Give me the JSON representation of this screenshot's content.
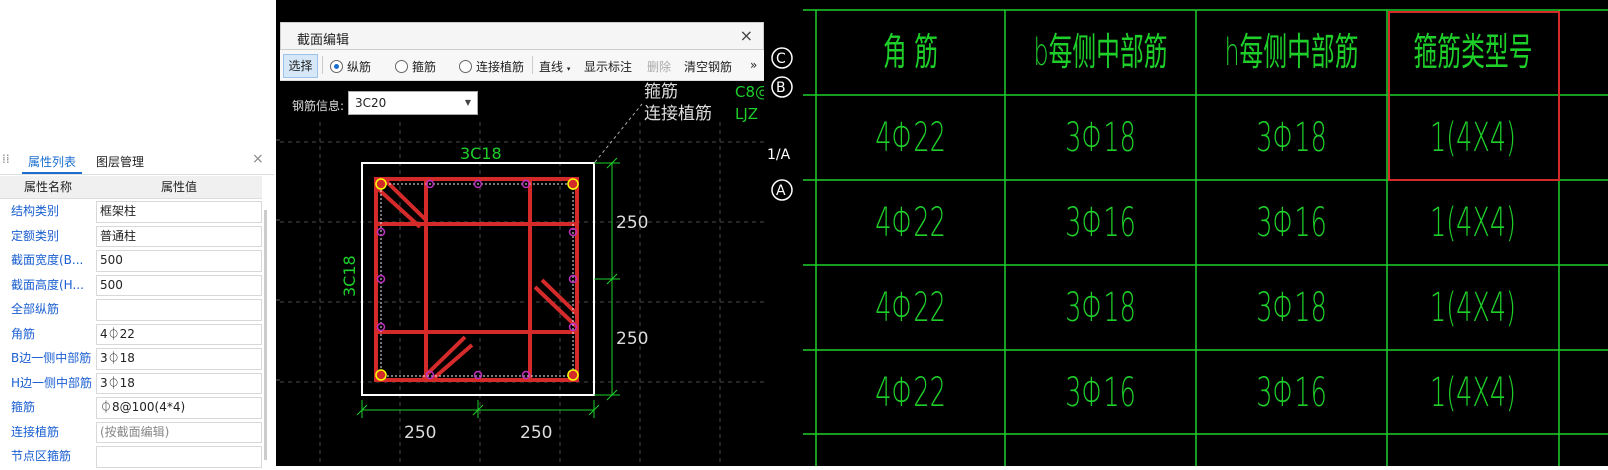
{
  "left_panel": {
    "tabs": [
      "属性列表",
      "图层管理"
    ],
    "close_icon": "×",
    "table_header": {
      "name": "属性名称",
      "value": "属性值"
    },
    "rows": [
      {
        "name": "结构类别",
        "value": "框架柱"
      },
      {
        "name": "定额类别",
        "value": "普通柱"
      },
      {
        "name": "截面宽度(B...",
        "value": "500"
      },
      {
        "name": "截面高度(H...",
        "value": "500"
      },
      {
        "name": "全部纵筋",
        "value": ""
      },
      {
        "name": "角筋",
        "value": "4⏀22"
      },
      {
        "name": "B边一侧中部筋",
        "value": "3⏀18"
      },
      {
        "name": "H边一侧中部筋",
        "value": "3⏀18"
      },
      {
        "name": "箍筋",
        "value": "⏀8@100(4*4)"
      },
      {
        "name": "连接植筋",
        "value": "(按截面编辑)"
      },
      {
        "name": "节点区箍筋",
        "value": ""
      }
    ]
  },
  "dialog": {
    "title": "截面编辑",
    "close": "×",
    "toolbar": {
      "select": "选择",
      "radio1": "纵筋",
      "radio2": "箍筋",
      "radio3": "连接植筋",
      "line": "直线",
      "show_label": "显示标注",
      "delete": "删除",
      "clear": "清空钢筋",
      "more": "»"
    },
    "steel_info_label": "钢筋信息:",
    "steel_info_value": "3C20"
  },
  "cad": {
    "top_label": "3C18",
    "side_label": "3C18",
    "dim_right": [
      "250",
      "250"
    ],
    "dim_bottom": [
      "250",
      "250"
    ],
    "legend1": "箍筋",
    "legend2": "连接植筋",
    "code1": "C8@",
    "code2": "LJZ",
    "axis_c": "C",
    "axis_b": "B",
    "axis_1a": "1/A",
    "axis_a": "A"
  },
  "right_table": {
    "headers": [
      "角 筋",
      "b每侧中部筋",
      "h每侧中部筋",
      "箍筋类型号"
    ],
    "rows": [
      [
        "4Φ22",
        "3Φ18",
        "3Φ18",
        "1(4X4)"
      ],
      [
        "4Φ22",
        "3Φ16",
        "3Φ16",
        "1(4X4)"
      ],
      [
        "4Φ22",
        "3Φ18",
        "3Φ18",
        "1(4X4)"
      ],
      [
        "4Φ22",
        "3Φ16",
        "3Φ16",
        "1(4X4)"
      ]
    ],
    "highlight_color": "#d42a2a",
    "line_color": "#1ecf2a"
  }
}
